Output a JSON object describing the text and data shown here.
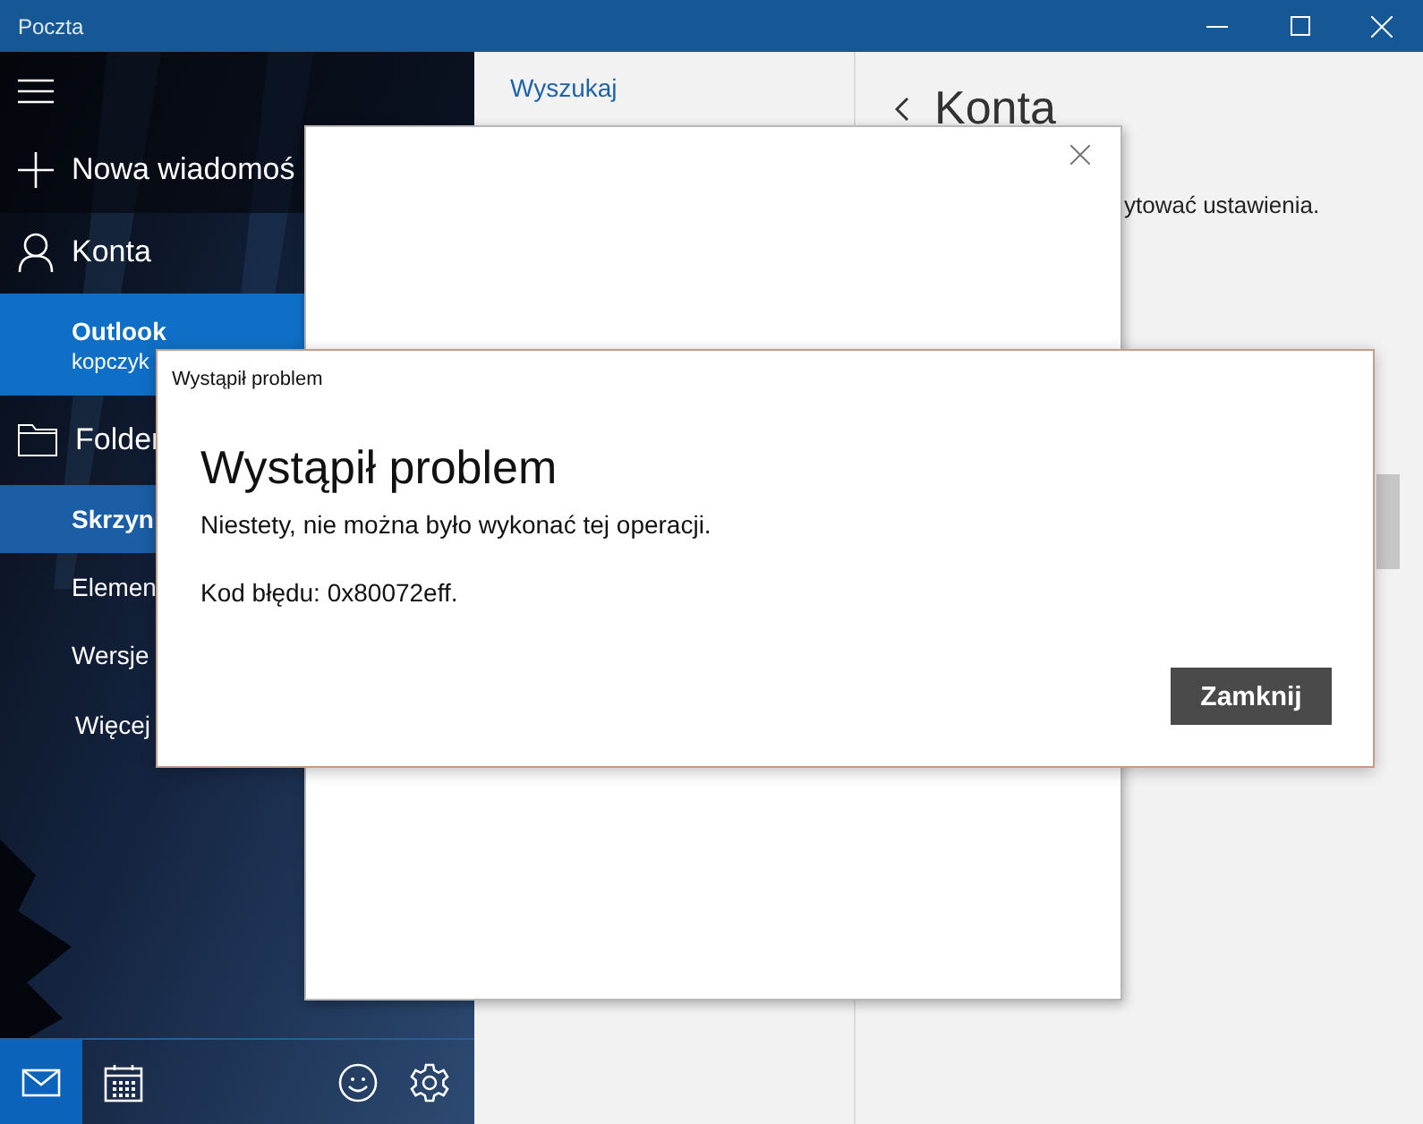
{
  "window": {
    "title": "Poczta"
  },
  "sidebar": {
    "new_message": "Nowa wiadomoś",
    "accounts_label": "Konta",
    "accounts": [
      {
        "name": "Outlook",
        "email": "kopczyk",
        "selected": true
      }
    ],
    "folders_label": "Folder",
    "folders": [
      {
        "label": "Skrzyn",
        "selected": true
      },
      {
        "label": "Elemen",
        "selected": false
      },
      {
        "label": "Wersje",
        "selected": false
      }
    ],
    "more": "Więcej",
    "bottom_nav": [
      {
        "kind": "mail",
        "selected": true
      },
      {
        "kind": "calendar",
        "selected": false
      },
      {
        "kind": "feedback",
        "selected": false
      },
      {
        "kind": "settings",
        "selected": false
      }
    ]
  },
  "message_list": {
    "search": "Wyszukaj"
  },
  "settings_pane": {
    "title": "Konta",
    "text": "ytować ustawienia."
  },
  "dialog": {
    "title": "Wystąpił problem",
    "heading": "Wystąpił problem",
    "message": "Niestety, nie można było wykonać tej operacji.",
    "error_code": "Kod błędu: 0x80072eff.",
    "button": "Zamknij"
  }
}
